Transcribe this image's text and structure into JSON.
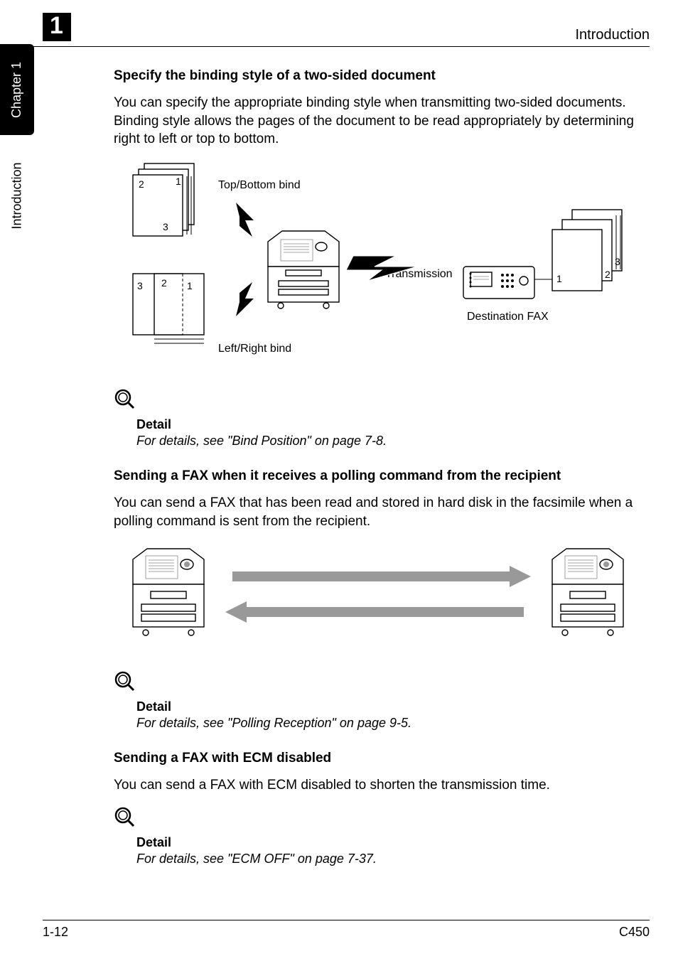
{
  "header": {
    "title": "Introduction",
    "chapter_num": "1"
  },
  "side_tabs": {
    "black": "Chapter 1",
    "gray": "Introduction"
  },
  "sections": [
    {
      "heading": "Specify the binding style of a two-sided document",
      "body": "You can specify the appropriate binding style when transmitting two-sided documents. Binding style allows the pages of the document to be read appropriately by determining right to left or top to bottom.",
      "diagram_labels": {
        "top_bind": "Top/Bottom bind",
        "left_bind": "Left/Right bind",
        "transmission": "Transmission",
        "destination": "Destination FAX"
      },
      "detail_label": "Detail",
      "detail_text": "For details, see \"Bind Position\" on page 7-8."
    },
    {
      "heading": "Sending a FAX when it receives a polling command from the recipient",
      "body": "You can send a FAX that has been read and stored in hard disk in the facsimile when a polling command is sent from the recipient.",
      "detail_label": "Detail",
      "detail_text": "For details, see \"Polling Reception\" on page 9-5."
    },
    {
      "heading": "Sending a FAX with ECM disabled",
      "body": "You can send a FAX with ECM disabled to shorten the transmission time.",
      "detail_label": "Detail",
      "detail_text": "For details, see \"ECM OFF\" on page 7-37."
    }
  ],
  "footer": {
    "page": "1-12",
    "model": "C450"
  }
}
